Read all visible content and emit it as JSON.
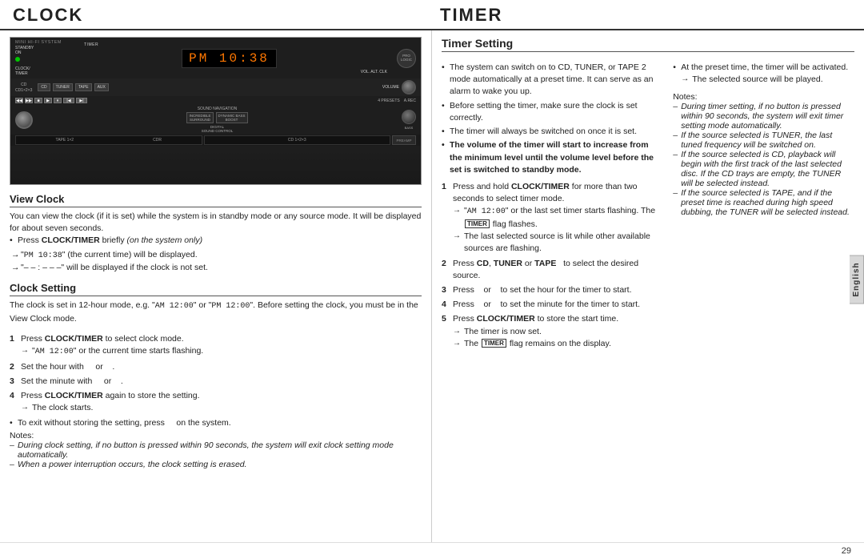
{
  "header": {
    "clock_title": "CLOCK",
    "timer_title": "TIMER"
  },
  "clock_section": {
    "view_clock": {
      "heading": "View Clock",
      "body": "You can view the clock (if it is set) while the system is in standby mode or any source mode. It will be displayed for about seven seconds.",
      "bullets": [
        {
          "text_parts": [
            {
              "text": "Press ",
              "bold": false
            },
            {
              "text": "CLOCK/TIMER",
              "bold": true
            },
            {
              "text": " briefly ",
              "bold": false
            },
            {
              "text": "(on the system only)",
              "bold": false,
              "italic": true
            }
          ]
        }
      ],
      "arrow1": "\"PM  10:38\" (the current time) will be displayed.",
      "arrow1_mono": "PM  10:38",
      "arrow2": "\"– – : – – –\" will be displayed if the clock is not set."
    },
    "clock_setting": {
      "heading": "Clock Setting",
      "body1": "The clock is set in 12-hour mode, e.g. \"",
      "body1_mono1": "AM  12:00",
      "body1_mid": "\" or \"",
      "body1_mono2": "PM  12:00",
      "body1_end": "\". Before setting the clock, you must be in the View Clock mode.",
      "steps": [
        {
          "num": "1",
          "parts": [
            {
              "text": "Press ",
              "bold": false
            },
            {
              "text": "CLOCK/TIMER",
              "bold": true
            },
            {
              "text": " to select clock mode.",
              "bold": false
            }
          ],
          "sub_arrow": "\"AM  12:00\" or the current time starts flashing."
        },
        {
          "num": "2",
          "parts": [
            {
              "text": "Set the hour with     or    .",
              "bold": false
            }
          ]
        },
        {
          "num": "3",
          "parts": [
            {
              "text": "Set the minute with     or    .",
              "bold": false
            }
          ]
        },
        {
          "num": "4",
          "parts": [
            {
              "text": "Press ",
              "bold": false
            },
            {
              "text": "CLOCK/TIMER",
              "bold": true
            },
            {
              "text": " again to store the setting.",
              "bold": false
            }
          ],
          "sub_arrow": "The clock starts."
        }
      ],
      "exit_note": "• To exit without storing the setting, press     on the system.",
      "notes_header": "Notes:",
      "notes": [
        "During clock setting,  if no button is pressed within 90 seconds, the system will exit clock setting mode automatically.",
        "When a power interruption occurs, the clock setting is erased."
      ]
    }
  },
  "timer_section": {
    "timer_setting": {
      "heading": "Timer Setting",
      "bullets": [
        "The system can switch on to CD, TUNER, or TAPE 2 mode automatically at a preset time. It can serve as an alarm to wake you up.",
        "Before setting the timer, make sure the clock is set correctly.",
        "The timer will always be switched on once it is set."
      ],
      "bold_bullet": "The volume of the timer will start to increase from the minimum level until the volume level before the set is switched to standby mode.",
      "steps": [
        {
          "num": "1",
          "parts": [
            {
              "text": "Press and hold ",
              "bold": false
            },
            {
              "text": "CLOCK/TIMER",
              "bold": true
            },
            {
              "text": " for more than two seconds to select timer mode.",
              "bold": false
            }
          ],
          "sub_arrow1": "\"AM  12:00\" or the last set timer starts flashing. The TIMER flag flashes.",
          "sub_arrow2": "The last selected source is lit while other available sources are flashing."
        },
        {
          "num": "2",
          "parts": [
            {
              "text": "Press ",
              "bold": false
            },
            {
              "text": "CD",
              "bold": true
            },
            {
              "text": ", ",
              "bold": false
            },
            {
              "text": "TUNER",
              "bold": true
            },
            {
              "text": " or ",
              "bold": false
            },
            {
              "text": "TAPE",
              "bold": true
            },
            {
              "text": "  to select the desired source.",
              "bold": false
            }
          ]
        },
        {
          "num": "3",
          "parts": [
            {
              "text": "Press     or     to set the hour for the timer to start.",
              "bold": false
            }
          ]
        },
        {
          "num": "4",
          "parts": [
            {
              "text": "Press     or     to set the minute for the timer to start.",
              "bold": false
            }
          ]
        },
        {
          "num": "5",
          "parts": [
            {
              "text": "Press ",
              "bold": false
            },
            {
              "text": "CLOCK/TIMER",
              "bold": true
            },
            {
              "text": " to store the start time.",
              "bold": false
            }
          ],
          "sub_arrow1": "The timer is now set.",
          "sub_arrow2": "The TIMER flag remains on the display."
        }
      ]
    },
    "right_column": {
      "preset_bullet": "At the preset time, the timer will be activated.",
      "arrow_selected": "The selected source will be played.",
      "notes_header": "Notes:",
      "notes": [
        "During timer setting, if no button is pressed within 90 seconds, the system will exit timer setting mode automatically.",
        "If the source selected is TUNER, the last tuned frequency will be switched on.",
        "If the source selected is CD, playback will begin with the first track of the last selected disc. If the CD trays are empty, the TUNER will be selected instead.",
        "If the source selected is TAPE, and if the preset time is reached during high speed dubbing, the TUNER will be selected instead."
      ]
    }
  },
  "page": {
    "number": "29",
    "language_tab": "English"
  },
  "device": {
    "display_text": "PM 10:38",
    "brand": "MINI HI-FI SYSTEM"
  }
}
